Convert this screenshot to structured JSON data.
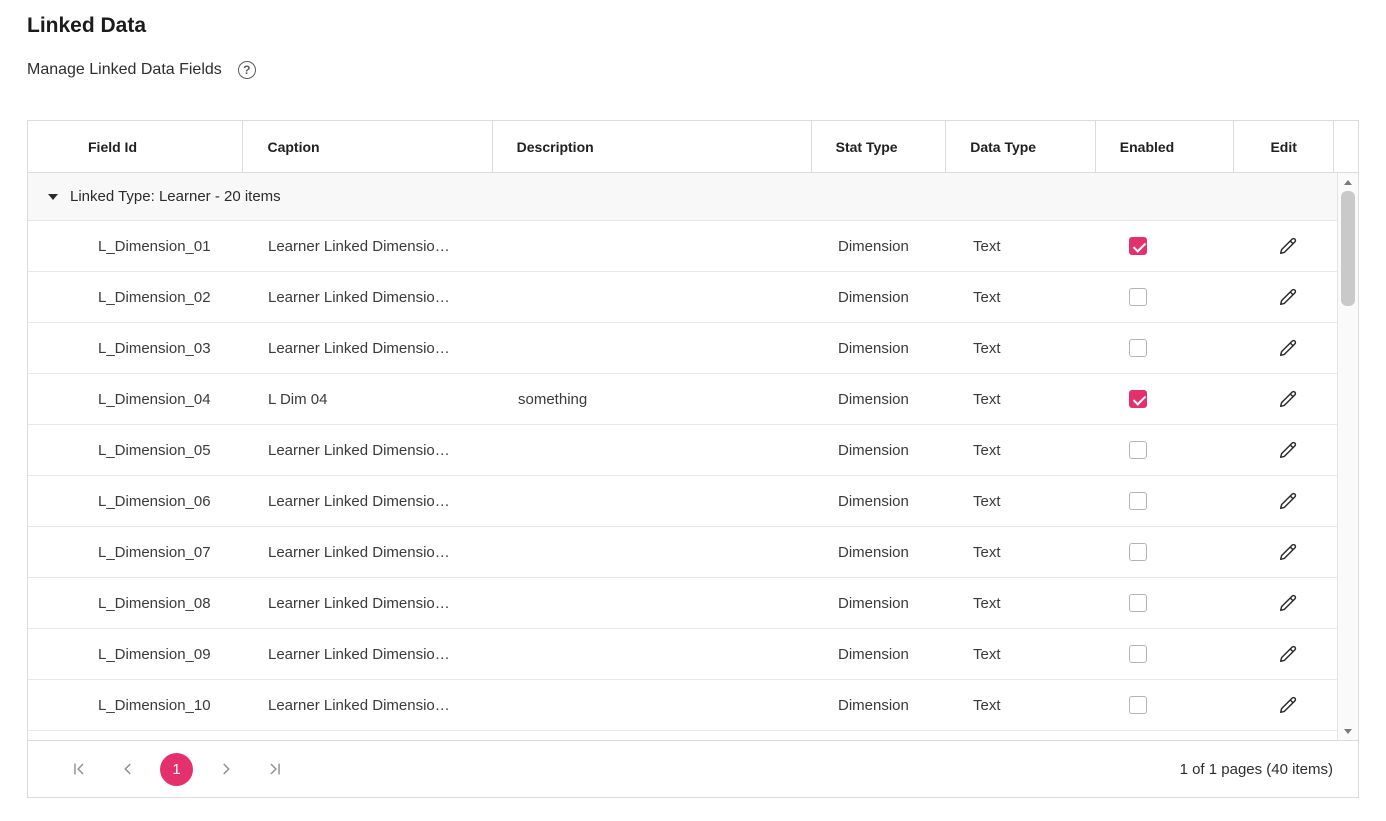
{
  "page": {
    "title": "Linked Data",
    "subtitle": "Manage Linked Data Fields",
    "help_label": "?"
  },
  "table": {
    "columns": [
      "Field Id",
      "Caption",
      "Description",
      "Stat Type",
      "Data Type",
      "Enabled",
      "Edit"
    ],
    "group_label": "Linked Type: Learner - 20 items",
    "rows": [
      {
        "field_id": "L_Dimension_01",
        "caption": "Learner Linked Dimensio…",
        "description": "",
        "stat_type": "Dimension",
        "data_type": "Text",
        "enabled": true
      },
      {
        "field_id": "L_Dimension_02",
        "caption": "Learner Linked Dimensio…",
        "description": "",
        "stat_type": "Dimension",
        "data_type": "Text",
        "enabled": false
      },
      {
        "field_id": "L_Dimension_03",
        "caption": "Learner Linked Dimensio…",
        "description": "",
        "stat_type": "Dimension",
        "data_type": "Text",
        "enabled": false
      },
      {
        "field_id": "L_Dimension_04",
        "caption": "L Dim 04",
        "description": "something",
        "stat_type": "Dimension",
        "data_type": "Text",
        "enabled": true
      },
      {
        "field_id": "L_Dimension_05",
        "caption": "Learner Linked Dimensio…",
        "description": "",
        "stat_type": "Dimension",
        "data_type": "Text",
        "enabled": false
      },
      {
        "field_id": "L_Dimension_06",
        "caption": "Learner Linked Dimensio…",
        "description": "",
        "stat_type": "Dimension",
        "data_type": "Text",
        "enabled": false
      },
      {
        "field_id": "L_Dimension_07",
        "caption": "Learner Linked Dimensio…",
        "description": "",
        "stat_type": "Dimension",
        "data_type": "Text",
        "enabled": false
      },
      {
        "field_id": "L_Dimension_08",
        "caption": "Learner Linked Dimensio…",
        "description": "",
        "stat_type": "Dimension",
        "data_type": "Text",
        "enabled": false
      },
      {
        "field_id": "L_Dimension_09",
        "caption": "Learner Linked Dimensio…",
        "description": "",
        "stat_type": "Dimension",
        "data_type": "Text",
        "enabled": false
      },
      {
        "field_id": "L_Dimension_10",
        "caption": "Learner Linked Dimensio…",
        "description": "",
        "stat_type": "Dimension",
        "data_type": "Text",
        "enabled": false
      }
    ]
  },
  "pager": {
    "current_page": "1",
    "info": "1 of 1 pages (40 items)"
  },
  "colors": {
    "accent": "#e4316d"
  }
}
